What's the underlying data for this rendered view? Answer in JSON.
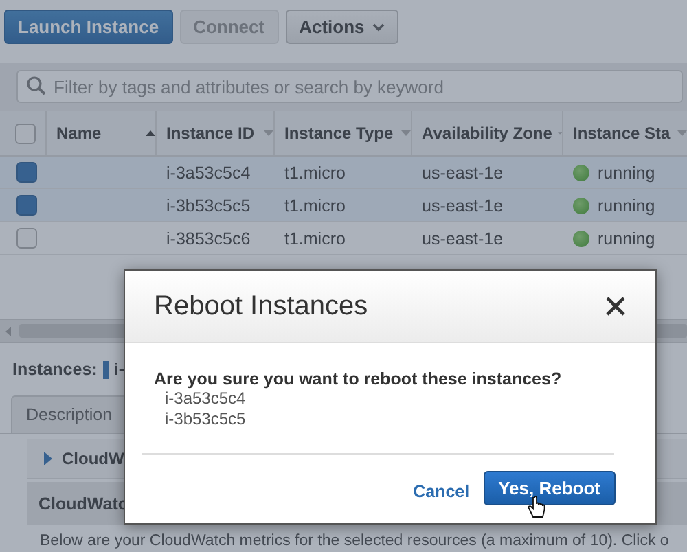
{
  "toolbar": {
    "buttons": [
      {
        "label": "Launch Instance",
        "kind": "primary"
      },
      {
        "label": "Connect",
        "kind": "disabled"
      },
      {
        "label": "Actions",
        "kind": "menu"
      }
    ]
  },
  "search": {
    "placeholder": "Filter by tags and attributes or search by keyword"
  },
  "table": {
    "select_all_checked": false,
    "columns": [
      {
        "label": "Name",
        "sorted": true
      },
      {
        "label": "Instance ID",
        "sorted": false
      },
      {
        "label": "Instance Type",
        "sorted": false
      },
      {
        "label": "Availability Zone",
        "sorted": false
      },
      {
        "label": "Instance Sta",
        "sorted": false
      }
    ],
    "rows": [
      {
        "selected": true,
        "instance_id": "i-3a53c5c4",
        "instance_type": "t1.micro",
        "availability_zone": "us-east-1e",
        "instance_state": "running"
      },
      {
        "selected": true,
        "instance_id": "i-3b53c5c5",
        "instance_type": "t1.micro",
        "availability_zone": "us-east-1e",
        "instance_state": "running"
      },
      {
        "selected": false,
        "instance_id": "i-3853c5c6",
        "instance_type": "t1.micro",
        "availability_zone": "us-east-1e",
        "instance_state": "running"
      }
    ]
  },
  "details": {
    "label": "Instances:",
    "selection": "i-",
    "tabs": [
      {
        "label": "Description"
      }
    ],
    "section": {
      "title": "CloudW",
      "expanded": false
    },
    "panel_title": "CloudWatc",
    "note": "Below are your CloudWatch metrics for the selected resources (a maximum of 10). Click o"
  },
  "dialog": {
    "title": "Reboot Instances",
    "message": "Are you sure you want to reboot these instances?",
    "items": [
      "i-3a53c5c4",
      "i-3b53c5c5"
    ],
    "buttons": [
      {
        "label": "Cancel",
        "kind": "link"
      },
      {
        "label": "Yes, Reboot",
        "kind": "primary"
      }
    ]
  }
}
